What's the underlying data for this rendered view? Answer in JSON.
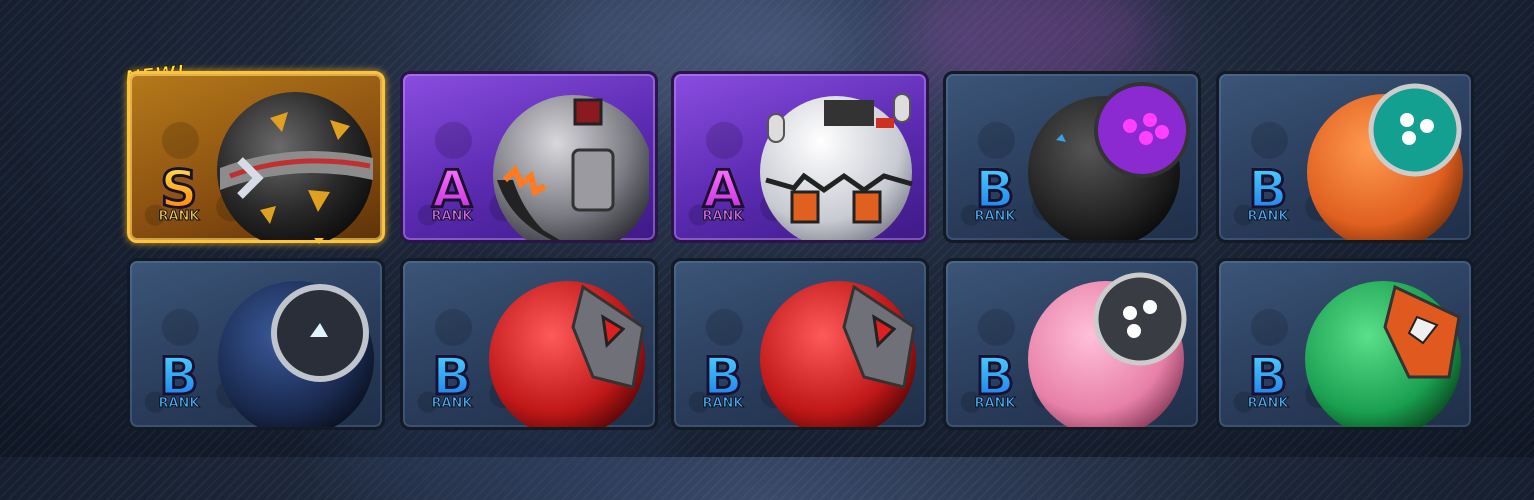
{
  "new_tag": "NEW!",
  "rank_word": "RANK",
  "colors": {
    "rank_s": "#ffb000",
    "rank_a": "#c02bd8",
    "rank_b": "#1878e8",
    "highlight": "#ffc338"
  },
  "cards": [
    {
      "rank": "S",
      "ball": "black-gold-ball-icon",
      "is_new": true
    },
    {
      "rank": "A",
      "ball": "silver-flame-ball-icon"
    },
    {
      "rank": "A",
      "ball": "white-robot-ball-icon"
    },
    {
      "rank": "B",
      "ball": "black-purple-ball-icon"
    },
    {
      "rank": "B",
      "ball": "orange-teal-ball-icon"
    },
    {
      "rank": "B",
      "ball": "navy-ball-icon"
    },
    {
      "rank": "B",
      "ball": "red-charge-ball-icon"
    },
    {
      "rank": "B",
      "ball": "red-charge-ball-icon"
    },
    {
      "rank": "B",
      "ball": "pink-ball-icon"
    },
    {
      "rank": "B",
      "ball": "green-orange-ball-icon"
    }
  ]
}
